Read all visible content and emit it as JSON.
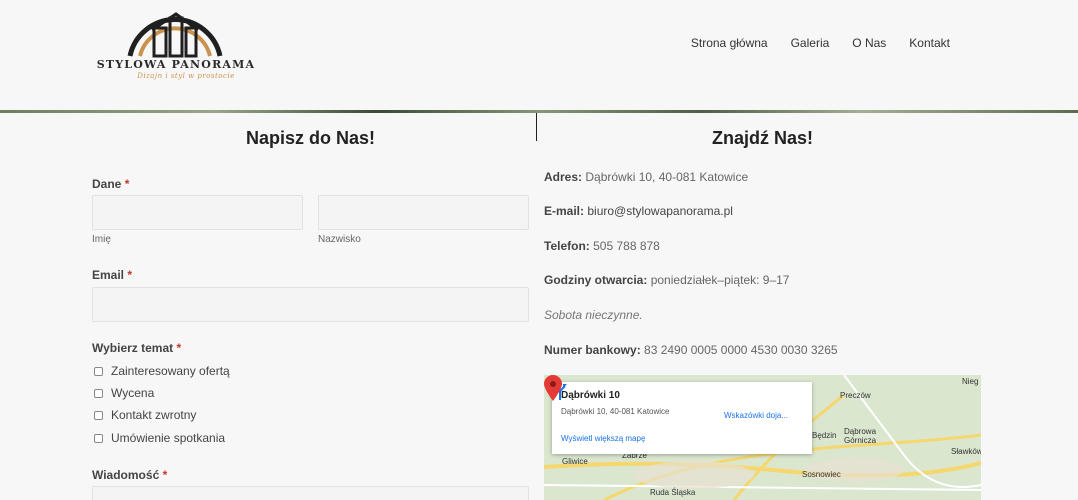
{
  "header": {
    "logo_title": "STYLOWA PANORAMA",
    "logo_tagline": "Dizajn i styl w prostocie",
    "nav": [
      "Strona główna",
      "Galeria",
      "O Nas",
      "Kontakt"
    ]
  },
  "contact_form": {
    "title": "Napisz do Nas!",
    "name_label": "Dane",
    "first_name_sublabel": "Imię",
    "last_name_sublabel": "Nazwisko",
    "email_label": "Email",
    "topic_label": "Wybierz temat",
    "topics": [
      "Zainteresowany ofertą",
      "Wycena",
      "Kontakt zwrotny",
      "Umówienie spotkania"
    ],
    "message_label": "Wiadomość",
    "required_marker": "*"
  },
  "find_us": {
    "title": "Znajdź Nas!",
    "address_label": "Adres:",
    "address_value": "Dąbrówki 10, 40-081 Katowice",
    "email_label": "E-mail:",
    "email_value": "biuro@stylowapanorama.pl",
    "phone_label": "Telefon:",
    "phone_value": "505 788 878",
    "hours_label": "Godziny otwarcia:",
    "hours_value": "poniedziałek–piątek: 9–17",
    "saturday_note": "Sobota nieczynne.",
    "bank_label": "Numer bankowy:",
    "bank_value": "83 2490 0005 0000 4530 0030 3265"
  },
  "map": {
    "place_title": "Dąbrówki 10",
    "place_address": "Dąbrówki 10, 40-081 Katowice",
    "larger_map_link": "Wyświetl większą mapę",
    "directions_label": "Wskazówki doja...",
    "labels": [
      "Gliwice",
      "Zabrze",
      "Ruda Śląska",
      "Sosnowiec",
      "Dąbrowa Górnicza",
      "Będzin",
      "Preczów",
      "Sławków",
      "Nieg"
    ],
    "colors": {
      "water_pin": "#e53935",
      "road": "#f5d76e",
      "land": "#dbe6cf"
    }
  },
  "colors": {
    "required": "#c0392b",
    "logo_gold": "#c9934f"
  }
}
